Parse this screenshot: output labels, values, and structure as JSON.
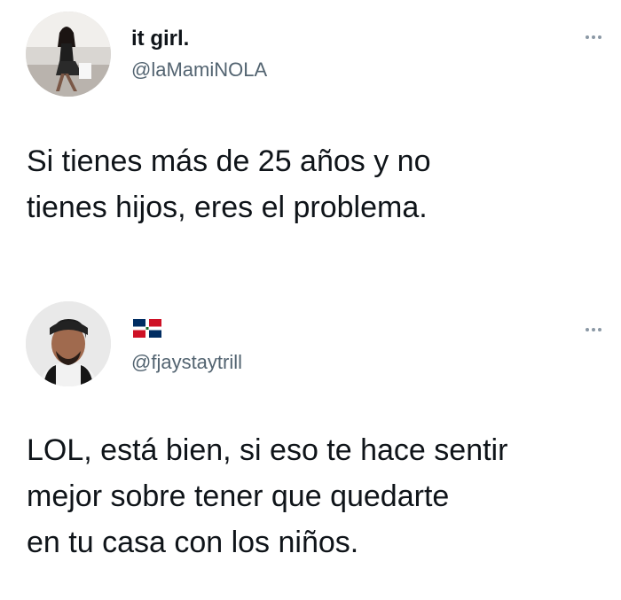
{
  "tweets": [
    {
      "display_name": "it girl.",
      "handle": "@laMamiNOLA",
      "text": "Si tienes más de 25 años y no\ntienes hijos, eres el problema.",
      "avatar_icon": "profile-photo-woman",
      "more_icon": "ellipsis-icon"
    },
    {
      "display_name_flag": "dominican-republic-flag-icon",
      "handle": "@fjaystaytrill",
      "text": "LOL, está bien, si eso te hace sentir\nmejor sobre tener que quedarte\nen tu casa con los niños.",
      "avatar_icon": "profile-photo-man",
      "more_icon": "ellipsis-icon"
    }
  ],
  "colors": {
    "text": "#0f1419",
    "secondary": "#536471",
    "flag_blue": "#002d62",
    "flag_red": "#ce1126",
    "background": "#ffffff"
  }
}
